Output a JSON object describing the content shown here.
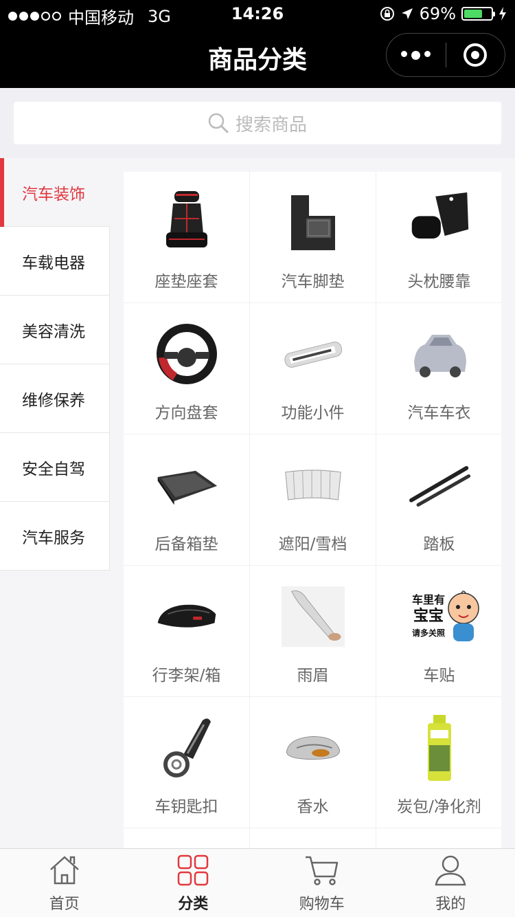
{
  "status_bar": {
    "carrier": "中国移动",
    "network": "3G",
    "time": "14:26",
    "battery": "69%",
    "battery_fraction": 0.69
  },
  "nav": {
    "title": "商品分类"
  },
  "search": {
    "placeholder": "搜索商品"
  },
  "sidebar": {
    "items": [
      {
        "label": "汽车装饰",
        "active": true
      },
      {
        "label": "车载电器"
      },
      {
        "label": "美容清洗"
      },
      {
        "label": "维修保养"
      },
      {
        "label": "安全自驾"
      },
      {
        "label": "汽车服务"
      }
    ]
  },
  "grid": {
    "items": [
      {
        "label": "座垫座套",
        "icon": "seat-cover-icon"
      },
      {
        "label": "汽车脚垫",
        "icon": "floor-mat-icon"
      },
      {
        "label": "头枕腰靠",
        "icon": "headrest-icon"
      },
      {
        "label": "方向盘套",
        "icon": "steering-wheel-icon"
      },
      {
        "label": "功能小件",
        "icon": "accessory-icon"
      },
      {
        "label": "汽车车衣",
        "icon": "car-cover-icon"
      },
      {
        "label": "后备箱垫",
        "icon": "trunk-mat-icon"
      },
      {
        "label": "遮阳/雪档",
        "icon": "sunshade-icon"
      },
      {
        "label": "踏板",
        "icon": "running-board-icon"
      },
      {
        "label": "行李架/箱",
        "icon": "roof-box-icon"
      },
      {
        "label": "雨眉",
        "icon": "rain-visor-icon"
      },
      {
        "label": "车贴",
        "icon": "car-sticker-icon"
      },
      {
        "label": "车钥匙扣",
        "icon": "keychain-icon"
      },
      {
        "label": "香水",
        "icon": "perfume-icon"
      },
      {
        "label": "炭包/净化剂",
        "icon": "purifier-icon"
      },
      {
        "label": "",
        "icon": ""
      },
      {
        "label": "",
        "icon": ""
      },
      {
        "label": "",
        "icon": ""
      }
    ],
    "sticker_text": [
      "车里有",
      "宝宝",
      "请多关照"
    ]
  },
  "tabbar": {
    "tabs": [
      {
        "label": "首页",
        "icon": "home-icon"
      },
      {
        "label": "分类",
        "icon": "category-icon",
        "active": true
      },
      {
        "label": "购物车",
        "icon": "cart-icon"
      },
      {
        "label": "我的",
        "icon": "profile-icon"
      }
    ]
  },
  "colors": {
    "accent": "#e0383e",
    "battery": "#4cd964"
  }
}
